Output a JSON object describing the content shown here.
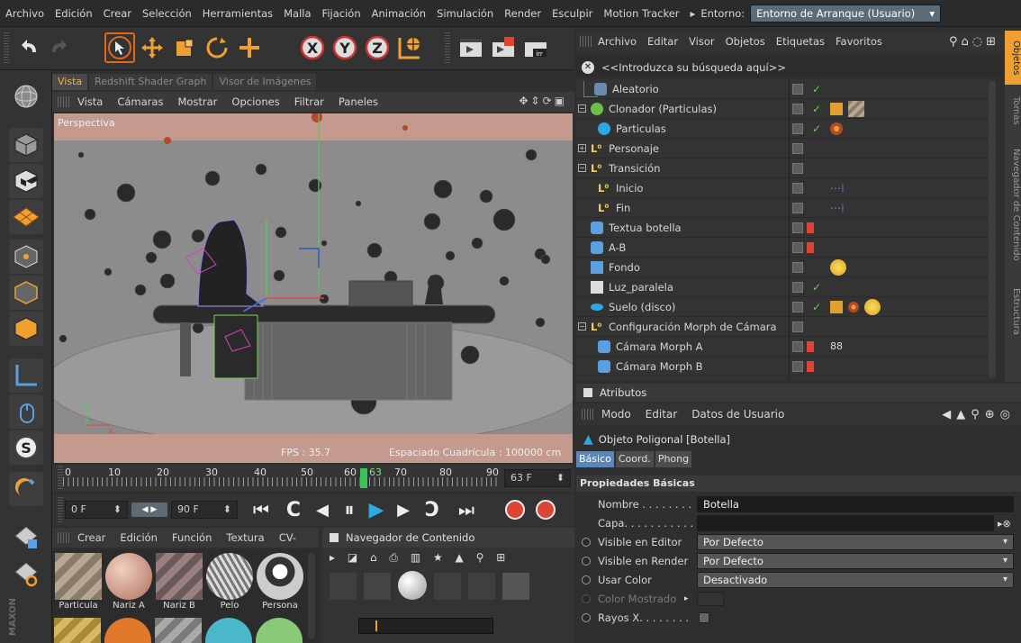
{
  "menubar": {
    "items": [
      "Archivo",
      "Edición",
      "Crear",
      "Selección",
      "Herramientas",
      "Malla",
      "Fijación",
      "Animación",
      "Simulación",
      "Render",
      "Esculpir",
      "Motion Tracker"
    ],
    "env_label": "Entorno:",
    "env_value": "Entorno de Arranque (Usuario)"
  },
  "viewport": {
    "tabs": [
      "Vista",
      "Redshift Shader Graph",
      "Visor de Imágenes"
    ],
    "menu": [
      "Vista",
      "Cámaras",
      "Mostrar",
      "Opciones",
      "Filtrar",
      "Paneles"
    ],
    "camera_label": "Perspectiva",
    "fps": "FPS : 35.7",
    "grid_spacing": "Espaciado Cuadrícula : 100000 cm"
  },
  "timeline": {
    "ticks": [
      "0",
      "10",
      "20",
      "30",
      "40",
      "50",
      "60",
      "63",
      "70",
      "80",
      "90"
    ],
    "current_frame": "63",
    "end_field": "63 F"
  },
  "transport": {
    "start": "0 F",
    "end": "90 F"
  },
  "materials": {
    "menu": [
      "Crear",
      "Edición",
      "Función",
      "Textura",
      "CV-"
    ],
    "items": [
      "Particula",
      "Nariz A",
      "Nariz B",
      "Pelo",
      "Persona"
    ]
  },
  "content_browser": {
    "title": "Navegador de Contenido"
  },
  "object_manager": {
    "menu": [
      "Archivo",
      "Editar",
      "Visor",
      "Objetos",
      "Etiquetas",
      "Favoritos"
    ],
    "search_placeholder": "<<Introduzca su búsqueda aquí>>",
    "objects": [
      {
        "name": "Aleatorio"
      },
      {
        "name": "Clonador (Particulas)"
      },
      {
        "name": "Particulas"
      },
      {
        "name": "Personaje"
      },
      {
        "name": "Transición"
      },
      {
        "name": "Inicio"
      },
      {
        "name": "Fin"
      },
      {
        "name": "Textua botella"
      },
      {
        "name": "A-B"
      },
      {
        "name": "Fondo"
      },
      {
        "name": "Luz_paralela"
      },
      {
        "name": "Suelo (disco)"
      },
      {
        "name": "Configuración Morph de Cámara"
      },
      {
        "name": "Cámara Morph A"
      },
      {
        "name": "Cámara Morph B"
      }
    ]
  },
  "right_tabs": [
    "Objetos",
    "Tomas",
    "Navegador de Contenido",
    "Estructura"
  ],
  "attributes": {
    "title": "Atributos",
    "menu": [
      "Modo",
      "Editar",
      "Datos de Usuario"
    ],
    "object": "Objeto Poligonal [Botella]",
    "tabs": [
      "Básico",
      "Coord.",
      "Phong"
    ],
    "section": "Propiedades Básicas",
    "props": [
      {
        "label": "Nombre . . . . . . . .",
        "value": "Botella"
      },
      {
        "label": "Capa. . . . . . . . . . .",
        "value": ""
      },
      {
        "label": "Visible en Editor",
        "value": "Por Defecto"
      },
      {
        "label": "Visible en Render",
        "value": "Por Defecto"
      },
      {
        "label": "Usar Color",
        "value": "Desactivado"
      },
      {
        "label": "Color Mostrado",
        "value": ""
      },
      {
        "label": "Rayos X. . . . . . . .",
        "value": ""
      }
    ]
  }
}
